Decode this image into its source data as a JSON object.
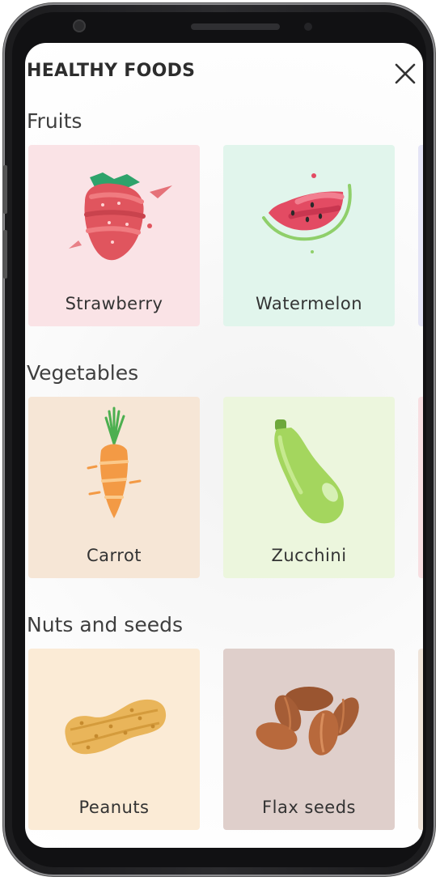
{
  "header": {
    "title": "HEALTHY FOODS"
  },
  "sections": [
    {
      "title": "Fruits",
      "items": [
        {
          "label": "Strawberry",
          "bg": "#fae3e6"
        },
        {
          "label": "Watermelon",
          "bg": "#e1f5ec"
        }
      ],
      "peek_bg": "#e4e4f6"
    },
    {
      "title": "Vegetables",
      "items": [
        {
          "label": "Carrot",
          "bg": "#f6e6d6"
        },
        {
          "label": "Zucchini",
          "bg": "#ecf6dd"
        }
      ],
      "peek_bg": "#f8dfe2"
    },
    {
      "title": "Nuts and seeds",
      "items": [
        {
          "label": "Peanuts",
          "bg": "#fbebd6"
        },
        {
          "label": "Flax seeds",
          "bg": "#dfcfcb"
        }
      ],
      "peek_bg": "#efe4da"
    }
  ],
  "icons": [
    "close-icon",
    "strawberry-icon",
    "watermelon-icon",
    "carrot-icon",
    "zucchini-icon",
    "peanut-icon",
    "flax-seeds-icon"
  ]
}
